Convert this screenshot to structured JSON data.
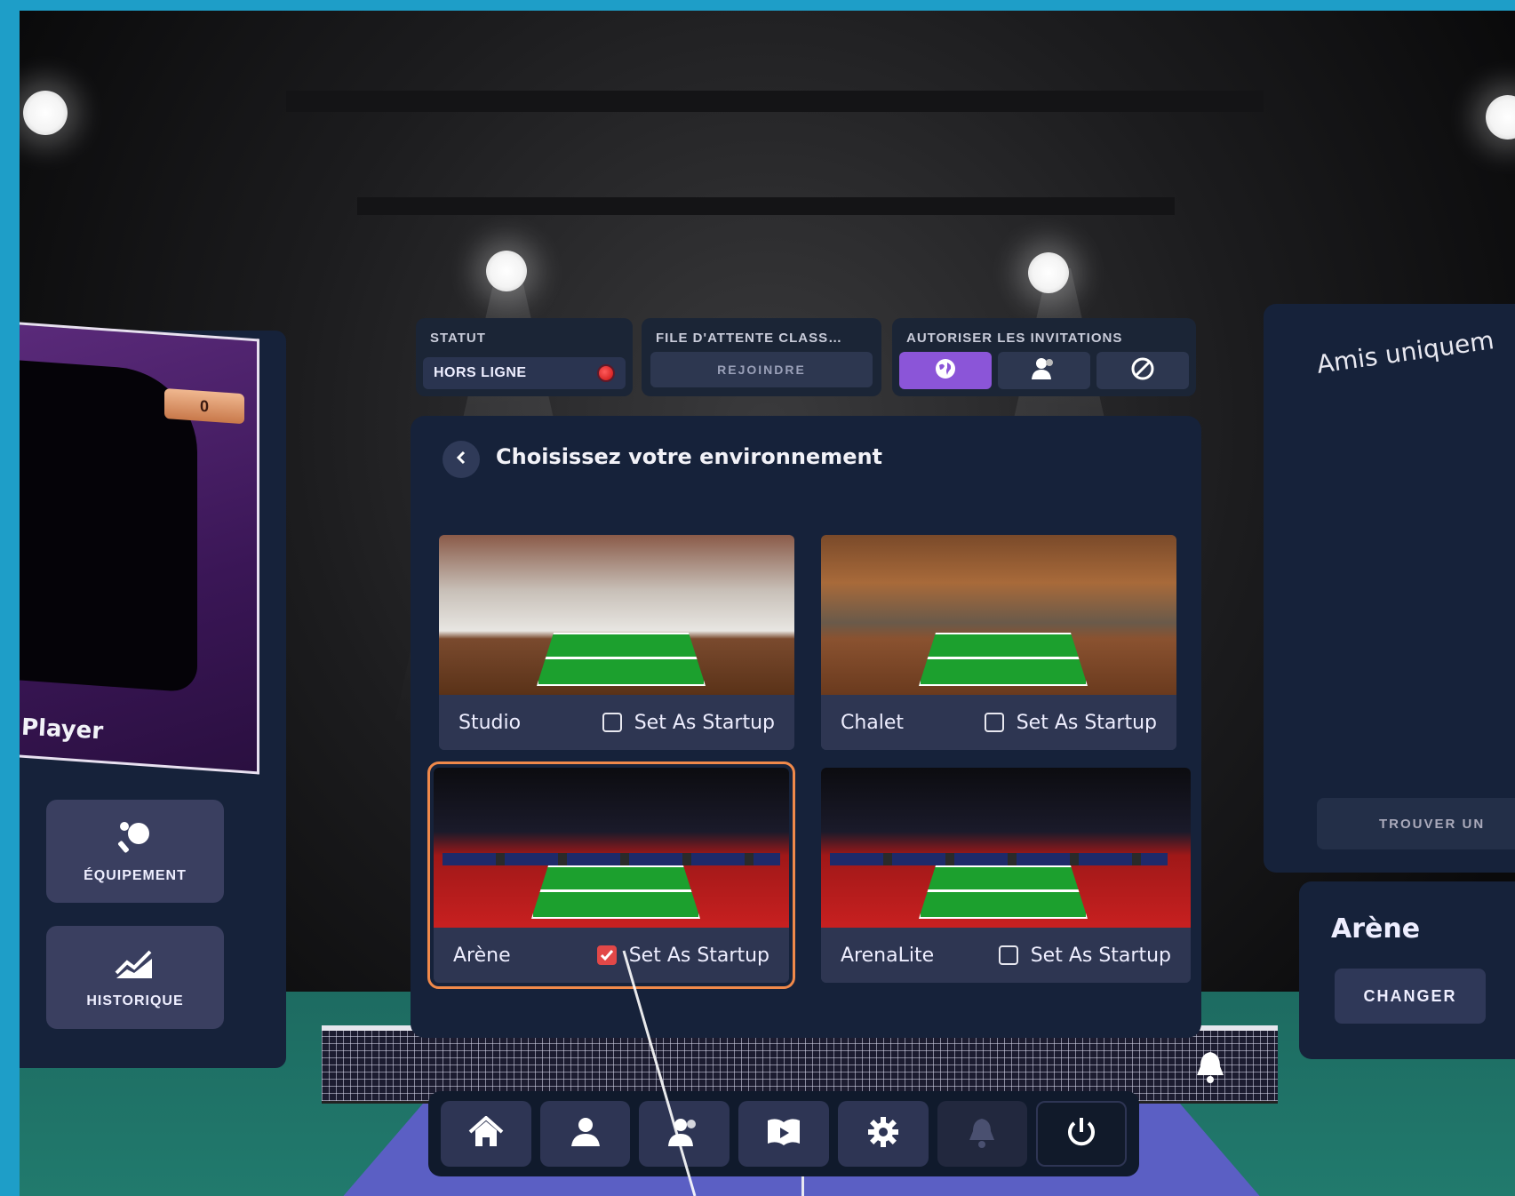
{
  "status": {
    "header": "STATUT",
    "value": "HORS LIGNE"
  },
  "queue": {
    "header": "FILE D'ATTENTE CLASS…",
    "join_label": "REJOINDRE"
  },
  "invites": {
    "header": "AUTORISER LES INVITATIONS",
    "options": [
      {
        "icon": "globe-icon",
        "active": true
      },
      {
        "icon": "friends-icon",
        "active": false
      },
      {
        "icon": "blocked-icon",
        "active": false
      }
    ]
  },
  "environment_panel": {
    "title": "Choisissez votre environnement",
    "environments": [
      {
        "name": "Studio",
        "startup_label": "Set As Startup",
        "is_startup": false,
        "selected": false
      },
      {
        "name": "Chalet",
        "startup_label": "Set As Startup",
        "is_startup": false,
        "selected": false
      },
      {
        "name": "Arène",
        "startup_label": "Set As Startup",
        "is_startup": true,
        "selected": true
      },
      {
        "name": "ArenaLite",
        "startup_label": "Set As Startup",
        "is_startup": false,
        "selected": false
      }
    ]
  },
  "player": {
    "name": "Player",
    "score": "0"
  },
  "side_menu": {
    "equipment_label": "ÉQUIPEMENT",
    "history_label": "HISTORIQUE"
  },
  "friends_panel": {
    "title": "Amis uniquem",
    "find_label": "TROUVER UN"
  },
  "current_environment": {
    "name": "Arène",
    "change_label": "CHANGER"
  },
  "bottom_nav": {
    "items": [
      "home-icon",
      "profile-icon",
      "friends-icon",
      "tutorial-icon",
      "settings-icon",
      "notifications-icon",
      "power-icon"
    ]
  },
  "colors": {
    "accent_purple": "#8b55d8",
    "selected_outline": "#f0894a",
    "status_offline": "#e02020",
    "checkbox_checked": "#e24848"
  }
}
